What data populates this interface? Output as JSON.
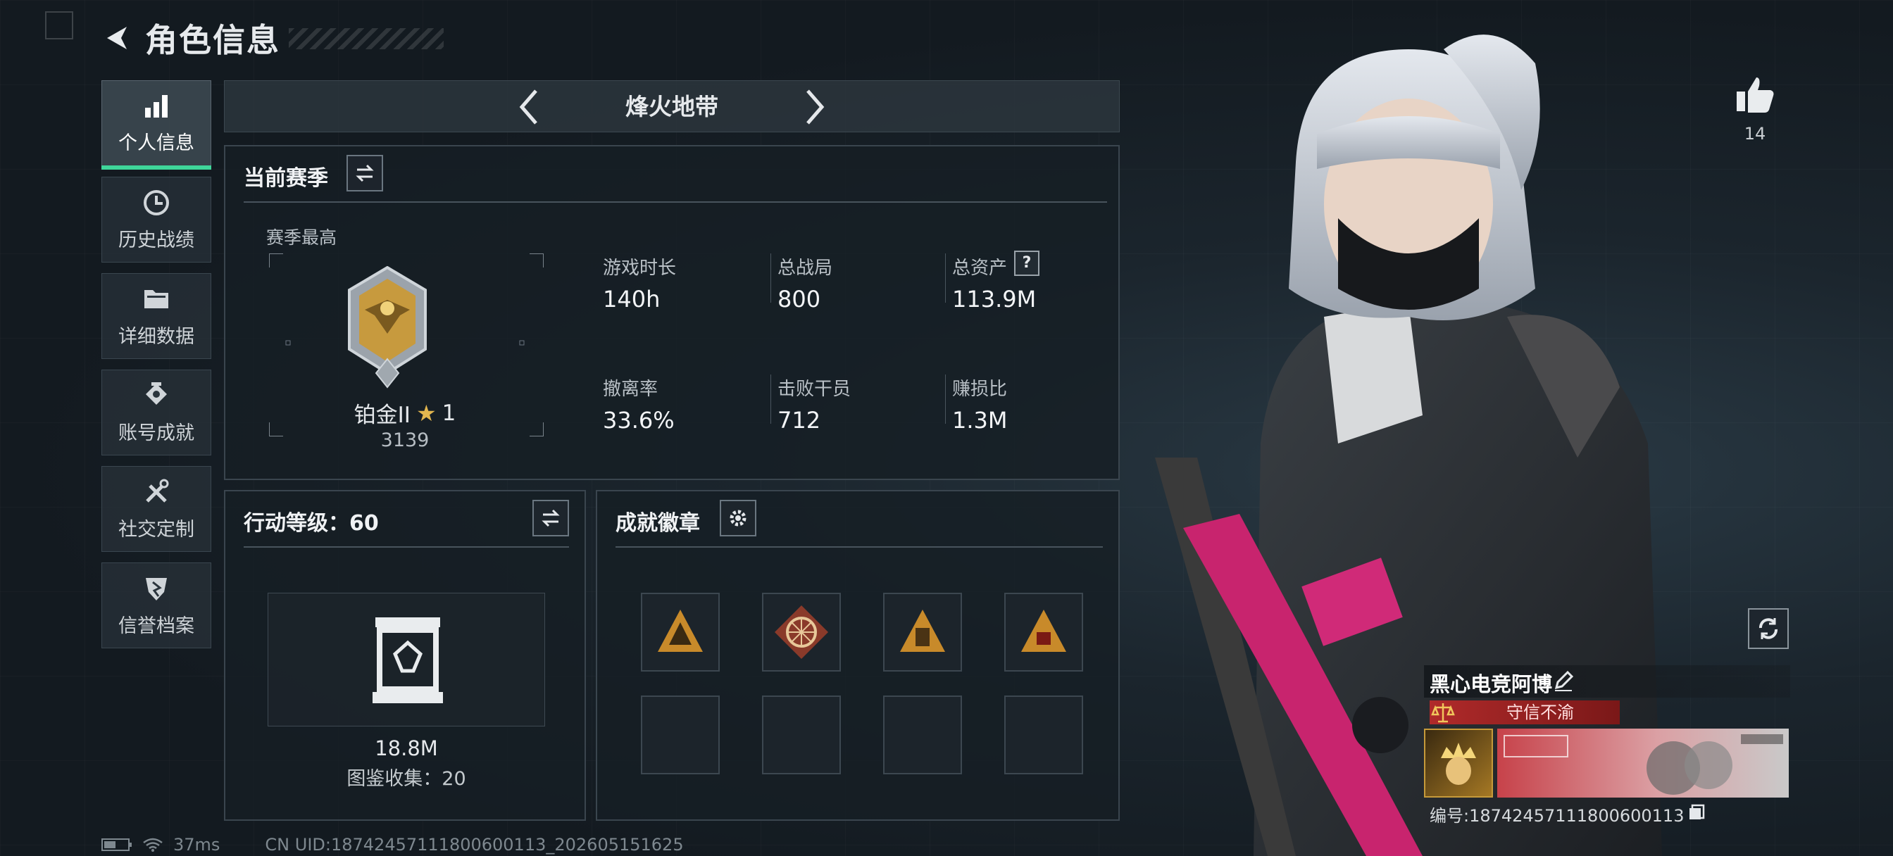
{
  "header": {
    "title": "角色信息"
  },
  "sidebar": {
    "items": [
      {
        "label": "个人信息",
        "icon": "bar-chart-icon"
      },
      {
        "label": "历史战绩",
        "icon": "history-clock-icon"
      },
      {
        "label": "详细数据",
        "icon": "folder-icon"
      },
      {
        "label": "账号成就",
        "icon": "achievement-icon"
      },
      {
        "label": "社交定制",
        "icon": "tools-icon"
      },
      {
        "label": "信誉档案",
        "icon": "shield-badge-icon"
      }
    ]
  },
  "mode": {
    "name": "烽火地带"
  },
  "season": {
    "title": "当前赛季",
    "best_label": "赛季最高",
    "rank_name": "铂金II",
    "rank_stars": "1",
    "rank_score": "3139",
    "stats": [
      {
        "label": "游戏时长",
        "value": "140h"
      },
      {
        "label": "总战局",
        "value": "800"
      },
      {
        "label": "总资产",
        "value": "113.9M"
      },
      {
        "label": "撤离率",
        "value": "33.6%"
      },
      {
        "label": "击败干员",
        "value": "712"
      },
      {
        "label": "赚损比",
        "value": "1.3M"
      }
    ],
    "help_symbol": "?"
  },
  "action_level": {
    "title": "行动等级：60",
    "value": "18.8M",
    "collection": "图鉴收集：20"
  },
  "badges": {
    "title": "成就徽章"
  },
  "likes": {
    "count": "14"
  },
  "player": {
    "name": "黑心电竞阿博",
    "title_badge": "守信不渝",
    "id_text": "编号:18742457111800600113"
  },
  "status": {
    "ping": "37ms",
    "uid": "CN UID:18742457111800600113_202605151625"
  },
  "colors": {
    "accent": "#3fd69a",
    "title_badge_bg": "#8e1e1e",
    "gun": "#c8246e"
  }
}
